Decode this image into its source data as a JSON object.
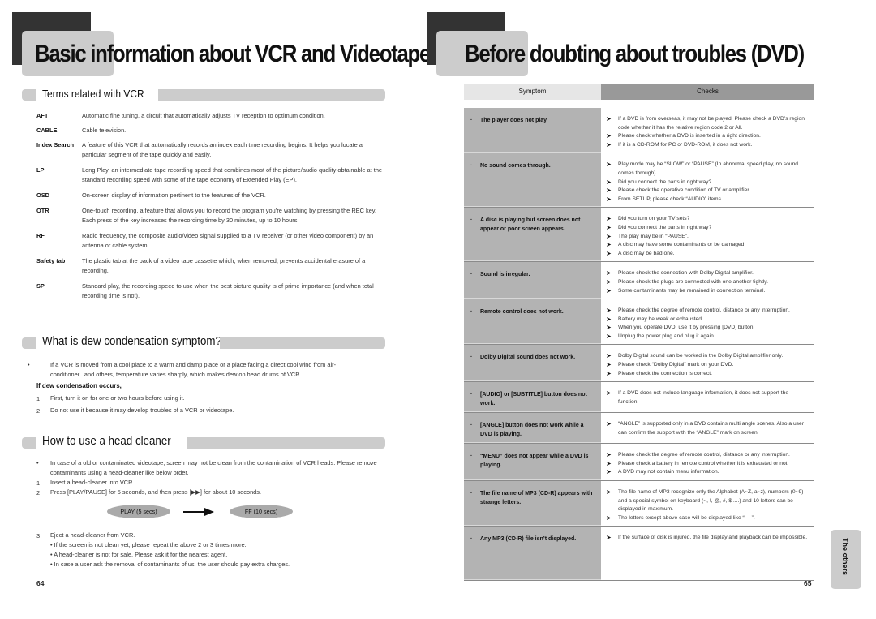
{
  "left_page": {
    "title": "Basic information about VCR and Videotape",
    "page_number": "64",
    "terms_section": {
      "title": "Terms related with VCR",
      "terms": [
        {
          "term": "AFT",
          "definition": "Automatic fine tuning, a circuit that automatically adjusts TV reception to optimum condition."
        },
        {
          "term": "CABLE",
          "definition": "Cable television."
        },
        {
          "term": "Index Search",
          "definition": "A feature of this VCR that automatically records an index each time recording begins. It helps you locate a particular segment of the tape quickly and easily."
        },
        {
          "term": "LP",
          "definition": "Long Play, an intermediate tape recording speed that combines most of the picture/audio quality obtainable at the standard recording speed with some of the tape economy of Extended Play (EP)."
        },
        {
          "term": "OSD",
          "definition": "On-screen display of information pertinent to the features of the VCR."
        },
        {
          "term": "OTR",
          "definition": "One-touch recording, a feature that allows you to record the program you’re watching by pressing the REC key. Each press of the key increases the recording time by 30 minutes, up to 10 hours."
        },
        {
          "term": "RF",
          "definition": "Radio frequency, the composite audio/video signal supplied to a TV receiver (or other video component) by an antenna or cable system."
        },
        {
          "term": "Safety tab",
          "definition": "The plastic tab at the back of a video tape cassette which, when removed, prevents accidental erasure of a recording."
        },
        {
          "term": "SP",
          "definition": "Standard play, the recording speed to use when the best picture quality is of prime importance (and when total recording time is not)."
        }
      ]
    },
    "dew_section": {
      "title": "What is dew condensation symptom?",
      "bullet": "If a VCR is moved from a cool place to a warm and damp place or a place facing a direct cool wind from air-conditioner...and others, temperature varies sharply, which makes dew on head drums of VCR.",
      "subheading": "If dew condensation occurs,",
      "steps": [
        {
          "n": "1",
          "text": "First, turn it on for one or two hours before using it."
        },
        {
          "n": "2",
          "text": "Do not use it because it may develop troubles of a VCR or videotape."
        }
      ]
    },
    "cleaner_section": {
      "title": "How to use a head cleaner",
      "bullet": "In case of a old or contaminated videotape, screen may not be clean from the contamination of VCR heads. Please remove contaminants using a head-cleaner like below order.",
      "steps": [
        {
          "n": "1",
          "text": "Insert a head-cleaner into VCR."
        },
        {
          "n": "2",
          "text": "Press [PLAY/PAUSE] for 5 seconds, and then press [▶▶] for about 10 seconds."
        },
        {
          "n": "3",
          "text": "Eject a head-cleaner from VCR."
        }
      ],
      "flow": {
        "from": "PLAY (5 secs)",
        "to": "FF (10 secs)"
      },
      "notes": [
        "If the screen is not clean yet, please repeat the above 2 or 3 times more.",
        "A head-cleaner is not for sale. Please ask it for the nearest agent.",
        "In case a user ask the removal of contaminants of us, the user should pay extra charges."
      ]
    }
  },
  "right_page": {
    "title": "Before doubting about troubles (DVD)",
    "page_number": "65",
    "side_tab": "The others",
    "table": {
      "headers": {
        "symptom": "Symptom",
        "checks": "Checks"
      },
      "rows": [
        {
          "symptom": "The player does not play.",
          "checks": [
            "If a DVD is from overseas, it may not be played. Please check a DVD’s region code whether it has the relative region code 2 or All.",
            "Please check whether a DVD is inserted in a right direction.",
            "If it is a CD-ROM for PC or DVD-ROM, it does not work."
          ]
        },
        {
          "symptom": "No sound comes through.",
          "checks": [
            "Play mode may be “SLOW” or “PAUSE” (In abnormal speed play, no sound comes through)",
            "Did you connect the parts in right way?",
            "Please check the operative condition of TV or amplifier.",
            "From SETUP, please check “AUDIO” items."
          ]
        },
        {
          "symptom": "A disc is playing but screen does not appear or poor screen appears.",
          "checks": [
            "Did you turn on your TV sets?",
            "Did you connect the parts in right way?",
            "The play may be in “PAUSE”.",
            "A disc may have some contaminants or be damaged.",
            "A disc may be bad one."
          ]
        },
        {
          "symptom": "Sound is irregular.",
          "checks": [
            "Please check the connection with Dolby Digital amplifier.",
            "Please check the plugs are connected with one another tightly.",
            "Some contaminants may be remained in connection terminal."
          ]
        },
        {
          "symptom": "Remote control does not work.",
          "checks": [
            "Please check the degree of remote control, distance or any interruption.",
            "Battery may be weak or exhausted.",
            "When you operate DVD, use it by pressing [DVD] button.",
            "Unplug the power plug and plug it again."
          ]
        },
        {
          "symptom": "Dolby Digital sound does not work.",
          "checks": [
            "Dolby Digital sound can be worked in the Dolby Digital amplifier only.",
            "Please check “Dolby Digital” mark on your DVD.",
            "Please check the connection is correct."
          ]
        },
        {
          "symptom": "[AUDIO] or [SUBTITLE] button does not work.",
          "checks": [
            "If a DVD does not include language information, it does not support the function."
          ]
        },
        {
          "symptom": "[ANGLE] button does not work while a DVD is playing.",
          "checks": [
            "“ANGLE” is supported only in a DVD contains multi angle scenes. Also a user can confirm the support with the “ANGLE” mark on screen."
          ]
        },
        {
          "symptom": "“MENU” does not appear while a DVD is playing.",
          "checks": [
            "Please check the degree of remote control, distance or any interruption.",
            "Please check a battery in remote control whether it is exhausted or not.",
            "A DVD may not contain menu information."
          ]
        },
        {
          "symptom": "The file name of MP3 (CD-R) appears with strange letters.",
          "checks": [
            "The file name of MP3 recognize only the Alphabet (A~Z, a~z), numbers (0~9) and a special symbol on keyboard (~, !, @, #, $ ....) and 10 letters can be displayed in maximum.",
            "The letters except above case will be displayed like “----”."
          ]
        },
        {
          "symptom": "Any MP3 (CD-R) file isn’t displayed.",
          "checks": [
            "If the surface of disk is injured, the file display and playback can be impossible."
          ]
        }
      ]
    }
  }
}
